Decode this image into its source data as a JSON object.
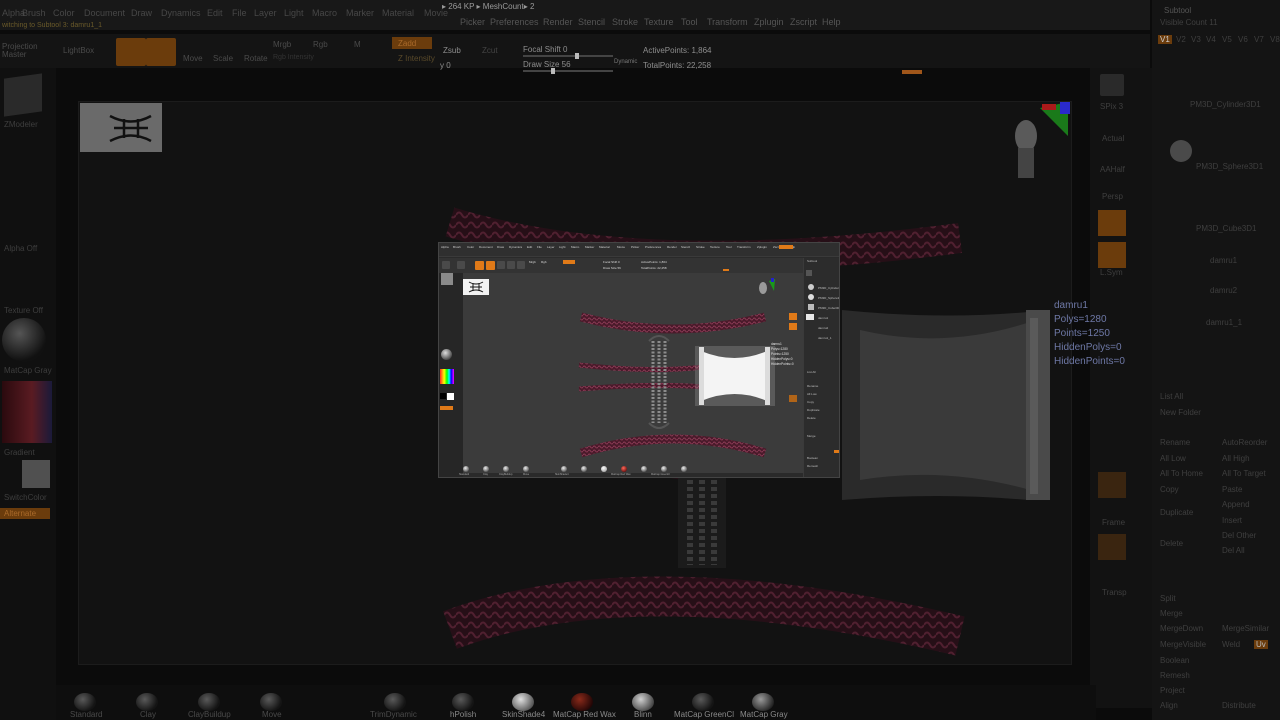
{
  "status": {
    "top_line": "▸ 264 KP ▸ MeshCount▸ 2",
    "project_line": "witching to Subtool 3: damru1_1"
  },
  "menus": [
    "Alpha",
    "Brush",
    "Color",
    "Document",
    "Draw",
    "Dynamics",
    "Edit",
    "File",
    "Layer",
    "Light",
    "Macro",
    "Marker",
    "Material",
    "Movie",
    "Picker",
    "Preferences",
    "Render",
    "Stencil",
    "Stroke",
    "Texture",
    "Tool",
    "Transform",
    "Zplugin",
    "Zscript",
    "Help"
  ],
  "toolbar": {
    "projection_master": "Projection Master",
    "lightbox": "LightBox",
    "edit": "Edit",
    "draw": "Draw",
    "move": "Move",
    "scale": "Scale",
    "rotate": "Rotate",
    "mrgb": "Mrgb",
    "rgb": "Rgb",
    "m": "M",
    "zadd": "Zadd",
    "zsub": "Zsub",
    "zcut": "Zcut",
    "rgb_intensity": "Rgb Intensity",
    "z_intensity": "Z Intensity",
    "focal_shift": "Focal Shift 0",
    "draw_size": "Draw Size 56",
    "dynamic": "Dynamic",
    "active_points": "ActivePoints: 1,864",
    "total_points": "TotalPoints: 22,258",
    "y_value": "y 0"
  },
  "left_shelf": {
    "zmodeler": "ZModeler",
    "alpha_off": "Alpha Off",
    "texture_off": "Texture Off",
    "matcap_gray": "MatCap Gray",
    "gradient": "Gradient",
    "switch_color": "SwitchColor",
    "alternate": "Alternate"
  },
  "right_shelf": {
    "spix": "SPix 3",
    "actual": "Actual",
    "aahalf": "AAHalf",
    "persp": "Persp",
    "floor": "Floor",
    "local": "L.Sym",
    "frame": "Frame",
    "solo": "Solo",
    "transp": "Transp"
  },
  "subtool": {
    "title": "Subtool",
    "visible_count": "Visible Count 11",
    "tabs": [
      "V1",
      "V2",
      "V3",
      "V4",
      "V5",
      "V6",
      "V7",
      "V8"
    ],
    "items": [
      "PM3D_Cylinder3D1",
      "PM3D_Sphere3D1",
      "PM3D_Cube3D1",
      "damru1",
      "damru2",
      "damru1_1"
    ],
    "buttons": [
      "List All",
      "New Folder",
      "Rename",
      "AutoReorder",
      "All Low",
      "All High",
      "All To Home",
      "All To Target",
      "Copy",
      "Paste",
      "Duplicate",
      "Append",
      "Insert",
      "Delete",
      "Del Other",
      "Del All",
      "Split",
      "Merge",
      "MergeDown",
      "MergeSimilar",
      "MergeVisible",
      "Weld",
      "Uv",
      "Boolean",
      "Remesh",
      "Project",
      "Extract",
      "Align",
      "Distribute"
    ]
  },
  "mesh_info": {
    "name": "damru1",
    "polys": "Polys=1280",
    "points": "Points=1250",
    "hidden_polys": "HiddenPolys=0",
    "hidden_points": "HiddenPoints=0"
  },
  "materials": [
    "Standard",
    "Clay",
    "ClayBuildup",
    "Move",
    "TrimDynamic",
    "hPolish",
    "SkinShade4",
    "MatCap Red Wax",
    "Blinn",
    "MatCap GreenCl",
    "MatCap Gray"
  ],
  "colors": {
    "accent_orange": "#e07a18",
    "rope_crimson": "#6a2a3a",
    "panel_dark": "#141414",
    "info_blue": "#6e78a6"
  }
}
